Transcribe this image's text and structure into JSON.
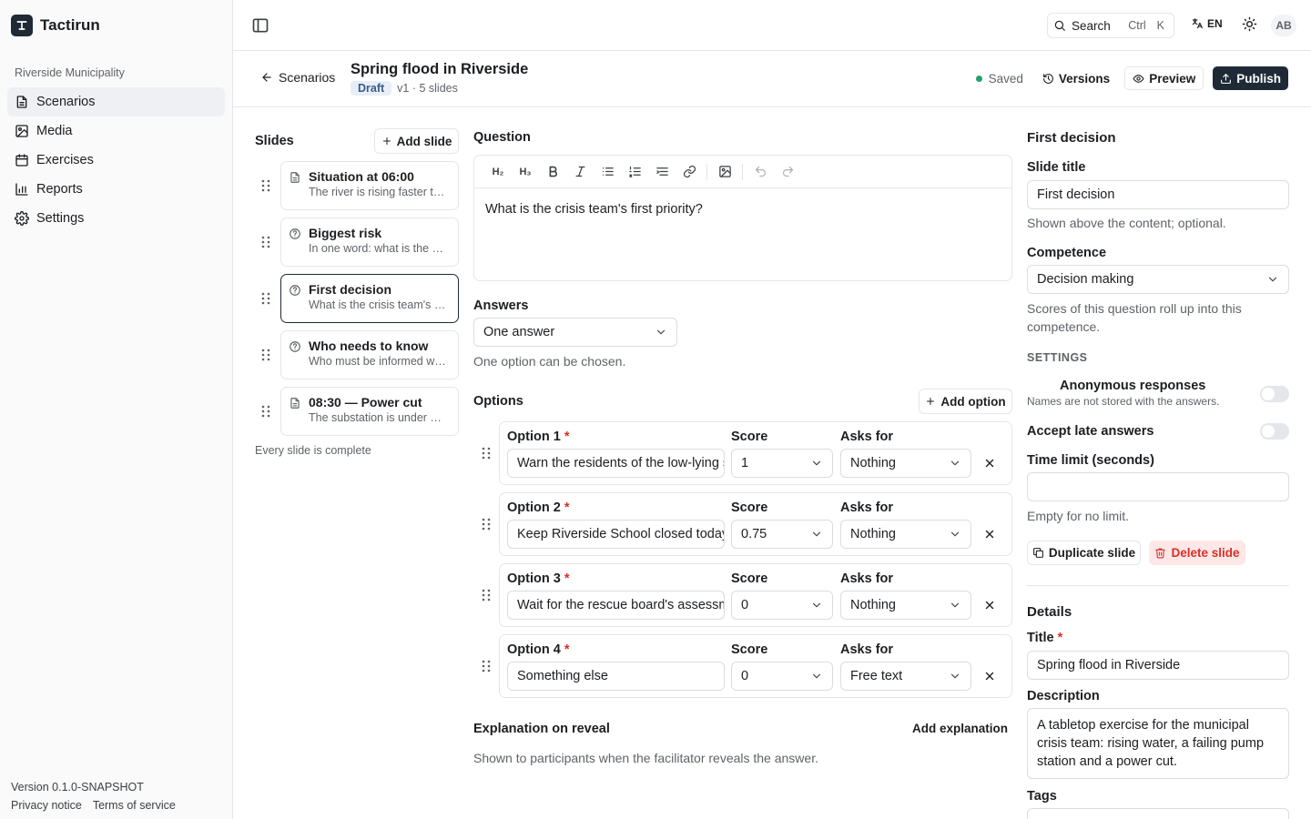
{
  "app": {
    "name": "Tactirun"
  },
  "sidebar": {
    "org": "Riverside Municipality",
    "items": [
      {
        "label": "Scenarios",
        "icon": "document-icon",
        "active": true
      },
      {
        "label": "Media",
        "icon": "image-icon"
      },
      {
        "label": "Exercises",
        "icon": "calendar-icon"
      },
      {
        "label": "Reports",
        "icon": "bar-chart-icon"
      },
      {
        "label": "Settings",
        "icon": "gear-icon"
      }
    ],
    "version": "Version 0.1.0-SNAPSHOT",
    "privacy": "Privacy notice",
    "terms": "Terms of service"
  },
  "topbar": {
    "search_label": "Search",
    "shortcut_ctrl": "Ctrl",
    "shortcut_key": "K",
    "language": "EN",
    "avatar": "AB"
  },
  "header": {
    "back_label": "Scenarios",
    "title": "Spring flood in Riverside",
    "status_badge": "Draft",
    "meta": "v1 · 5 slides",
    "saved": "Saved",
    "versions": "Versions",
    "preview": "Preview",
    "publish": "Publish"
  },
  "slides": {
    "title": "Slides",
    "add_label": "Add slide",
    "status": "Every slide is complete",
    "items": [
      {
        "name": "Situation at 06:00",
        "desc": "The river is rising faster than expected.",
        "icon": "document-icon"
      },
      {
        "name": "Biggest risk",
        "desc": "In one word: what is the biggest risk?",
        "icon": "question-circle-icon"
      },
      {
        "name": "First decision",
        "desc": "What is the crisis team's first priority?",
        "icon": "question-circle-icon",
        "selected": true
      },
      {
        "name": "Who needs to know",
        "desc": "Who must be informed without delay?",
        "icon": "question-circle-icon"
      },
      {
        "name": "08:30 — Power cut",
        "desc": "The substation is under water.",
        "icon": "document-icon"
      }
    ]
  },
  "question": {
    "label": "Question",
    "toolbar": {
      "h2": "H₂",
      "h3": "H₃"
    },
    "content": "What is the crisis team's first priority?"
  },
  "answers": {
    "label": "Answers",
    "mode": "One answer",
    "help": "One option can be chosen."
  },
  "options": {
    "label": "Options",
    "add_label": "Add option",
    "score_label": "Score",
    "asks_label": "Asks for",
    "items": [
      {
        "label": "Option 1",
        "text": "Warn the residents of the low-lying streets",
        "score": "1",
        "asks": "Nothing"
      },
      {
        "label": "Option 2",
        "text": "Keep Riverside School closed today",
        "score": "0.75",
        "asks": "Nothing"
      },
      {
        "label": "Option 3",
        "text": "Wait for the rescue board's assessment",
        "score": "0",
        "asks": "Nothing"
      },
      {
        "label": "Option 4",
        "text": "Something else",
        "score": "0",
        "asks": "Free text"
      }
    ]
  },
  "explanation": {
    "label": "Explanation on reveal",
    "add_label": "Add explanation",
    "help": "Shown to participants when the facilitator reveals the answer."
  },
  "panel": {
    "title": "First decision",
    "slide_title_label": "Slide title",
    "slide_title_value": "First decision",
    "slide_title_help": "Shown above the content; optional.",
    "competence_label": "Competence",
    "competence_value": "Decision making",
    "competence_help": "Scores of this question roll up into this competence.",
    "settings_heading": "SETTINGS",
    "anon_title": "Anonymous responses",
    "anon_help": "Names are not stored with the answers.",
    "anon_on": false,
    "late_label": "Accept late answers",
    "late_on": false,
    "time_limit_label": "Time limit (seconds)",
    "time_limit_value": "",
    "time_limit_help": "Empty for no limit.",
    "duplicate": "Duplicate slide",
    "delete": "Delete slide",
    "details_title": "Details",
    "title_label": "Title",
    "title_value": "Spring flood in Riverside",
    "description_label": "Description",
    "description_value": "A tabletop exercise for the municipal crisis team: rising water, a failing pump station and a power cut.",
    "tags_label": "Tags"
  }
}
